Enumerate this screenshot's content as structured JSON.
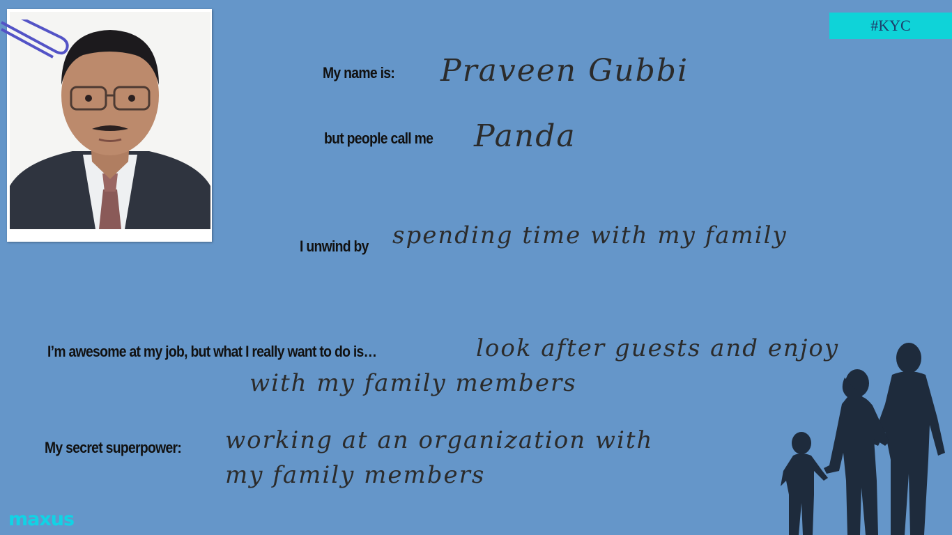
{
  "tag": "#KYC",
  "brand": "maxus",
  "colors": {
    "background": "#6596c9",
    "tag_bg": "#0fd3d8",
    "brand": "#11d3e5",
    "silhouette": "#1e2b3c"
  },
  "icons": [
    "paperclip-icon",
    "family-silhouette-icon"
  ],
  "profile": {
    "name_label": "My name is:",
    "name_value": "Praveen Gubbi",
    "nickname_label": "but people  call me",
    "nickname_value": "Panda",
    "unwind_label": "I unwind by",
    "unwind_value": "spending time with my family",
    "dream_label": "I’m awesome at my job, but what I really want to do is…",
    "dream_value_line1": "look after guests and enjoy",
    "dream_value_line2": "with my family members",
    "superpower_label": "My secret superpower:",
    "superpower_value_line1": "working at an organization with",
    "superpower_value_line2": "my family members"
  }
}
